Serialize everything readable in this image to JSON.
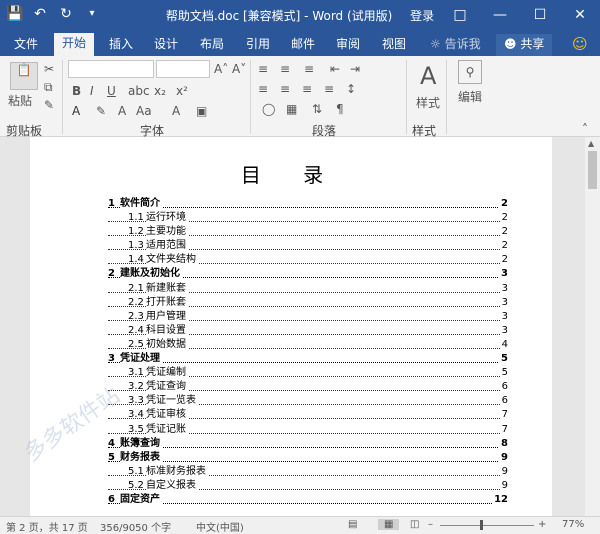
{
  "titlebar": {
    "title": "帮助文档.doc [兼容模式] - Word (试用版)",
    "login": "登录",
    "save_icon": "save-icon",
    "undo_icon": "undo-icon",
    "redo_icon": "redo-icon"
  },
  "tabs": [
    "文件",
    "开始",
    "插入",
    "设计",
    "布局",
    "引用",
    "邮件",
    "审阅",
    "视图"
  ],
  "tell_me": "告诉我",
  "share": "共享",
  "ribbon": {
    "paste": "粘贴",
    "groups": {
      "clipboard": "剪贴板",
      "font": "字体",
      "paragraph": "段落",
      "styles": "样式",
      "editing": "编辑"
    },
    "styles_btn": "样式",
    "editing_btn": "编辑"
  },
  "document": {
    "heading": "目 录",
    "toc": [
      {
        "level": 1,
        "num": "1",
        "label": "软件简介",
        "page": "2"
      },
      {
        "level": 2,
        "num": "1.1",
        "label": "运行环境",
        "page": "2"
      },
      {
        "level": 2,
        "num": "1.2",
        "label": "主要功能",
        "page": "2"
      },
      {
        "level": 2,
        "num": "1.3",
        "label": "适用范围",
        "page": "2"
      },
      {
        "level": 2,
        "num": "1.4",
        "label": "文件夹结构",
        "page": "2"
      },
      {
        "level": 1,
        "num": "2",
        "label": "建账及初始化",
        "page": "3"
      },
      {
        "level": 2,
        "num": "2.1",
        "label": "新建账套",
        "page": "3"
      },
      {
        "level": 2,
        "num": "2.2",
        "label": "打开账套",
        "page": "3"
      },
      {
        "level": 2,
        "num": "2.3",
        "label": "用户管理",
        "page": "3"
      },
      {
        "level": 2,
        "num": "2.4",
        "label": "科目设置",
        "page": "3"
      },
      {
        "level": 2,
        "num": "2.5",
        "label": "初始数据",
        "page": "4"
      },
      {
        "level": 1,
        "num": "3",
        "label": "凭证处理",
        "page": "5"
      },
      {
        "level": 2,
        "num": "3.1",
        "label": "凭证编制",
        "page": "5"
      },
      {
        "level": 2,
        "num": "3.2",
        "label": "凭证查询",
        "page": "6"
      },
      {
        "level": 2,
        "num": "3.3",
        "label": "凭证一览表",
        "page": "6"
      },
      {
        "level": 2,
        "num": "3.4",
        "label": "凭证审核",
        "page": "7"
      },
      {
        "level": 2,
        "num": "3.5",
        "label": "凭证记账",
        "page": "7"
      },
      {
        "level": 1,
        "num": "4",
        "label": "账簿查询",
        "page": "8"
      },
      {
        "level": 1,
        "num": "5",
        "label": "财务报表",
        "page": "9"
      },
      {
        "level": 2,
        "num": "5.1",
        "label": "标准财务报表",
        "page": "9"
      },
      {
        "level": 2,
        "num": "5.2",
        "label": "自定义报表",
        "page": "9"
      },
      {
        "level": 1,
        "num": "6",
        "label": "固定资产",
        "page": "12"
      }
    ]
  },
  "statusbar": {
    "page": "第 2 页，共 17 页",
    "words": "356/9050 个字",
    "lang": "中文(中国)",
    "zoom": "77%",
    "zoom_value": 0.77
  },
  "watermark": "多多软件站",
  "colors": {
    "accent": "#2b579a"
  }
}
